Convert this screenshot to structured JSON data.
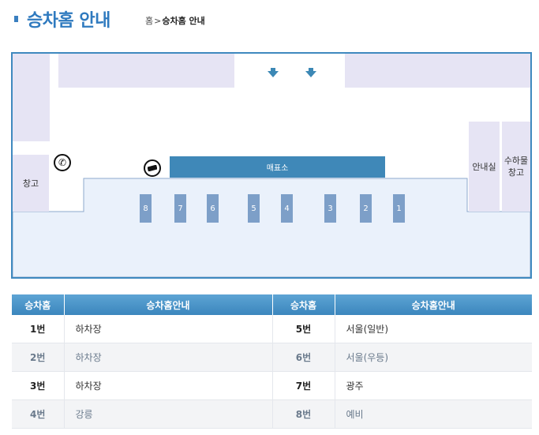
{
  "header": {
    "title": "승차홈 안내",
    "breadcrumb": {
      "home": "홈",
      "separator": ">",
      "current": "승차홈 안내"
    }
  },
  "map": {
    "kiosk_label": "매표소",
    "storage_left_label": "창고",
    "info_room_label": "안내실",
    "cargo_storage_label_line1": "수하물",
    "cargo_storage_label_line2": "창고",
    "phone_icon": "phone-icon",
    "atm_icon": "card-reader-icon",
    "gates": [
      "8",
      "7",
      "6",
      "5",
      "4",
      "3",
      "2",
      "1"
    ],
    "colors": {
      "border": "#3f89bf",
      "zone": "#e6e4f4",
      "platform": "#eaf1fb",
      "kiosk": "#3f88b8",
      "gate": "#7d9fc8"
    }
  },
  "table": {
    "headers": [
      "승차홈",
      "승차홈안내",
      "승차홈",
      "승차홈안내"
    ],
    "rows": [
      {
        "left_num": "1번",
        "left_dest": "하차장",
        "right_num": "5번",
        "right_dest": "서울(일반)"
      },
      {
        "left_num": "2번",
        "left_dest": "하차장",
        "right_num": "6번",
        "right_dest": "서울(우등)"
      },
      {
        "left_num": "3번",
        "left_dest": "하차장",
        "right_num": "7번",
        "right_dest": "광주"
      },
      {
        "left_num": "4번",
        "left_dest": "강릉",
        "right_num": "8번",
        "right_dest": "예비"
      }
    ]
  }
}
